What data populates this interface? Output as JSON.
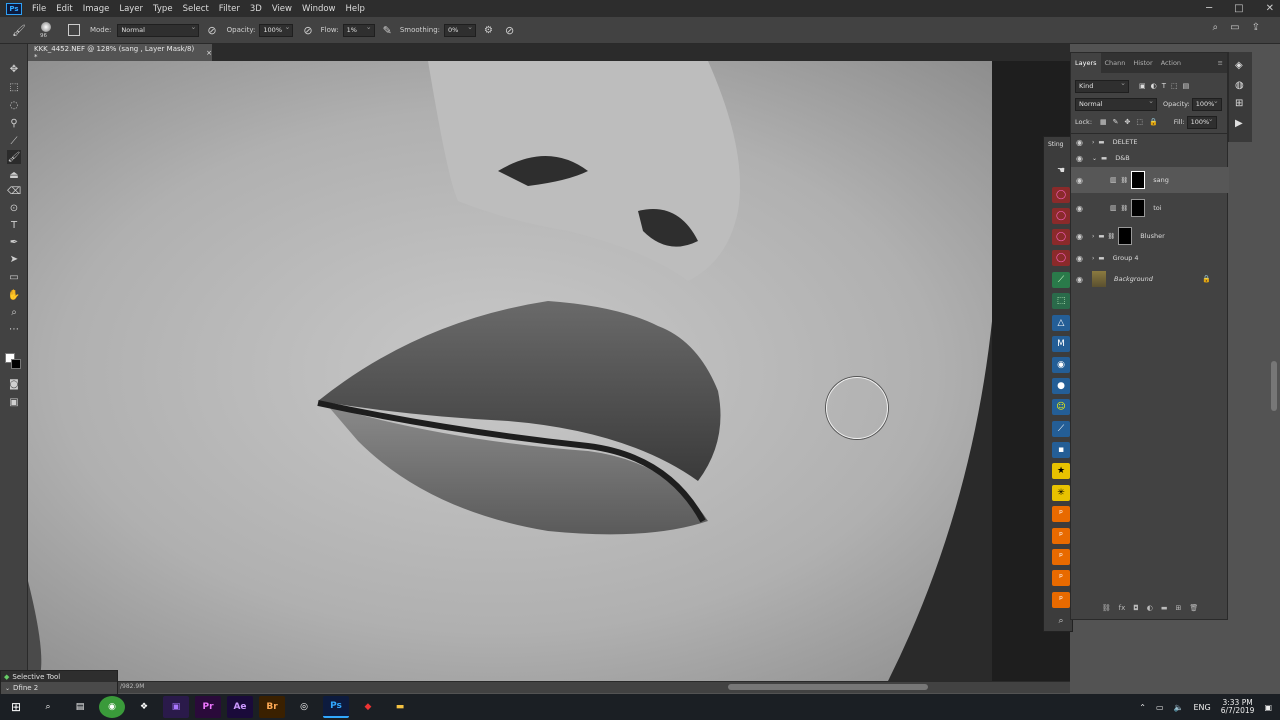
{
  "menubar": {
    "app_icon": "Ps",
    "items": [
      "File",
      "Edit",
      "Image",
      "Layer",
      "Type",
      "Select",
      "Filter",
      "3D",
      "View",
      "Window",
      "Help"
    ]
  },
  "window_controls": {
    "minimize": "─",
    "maximize": "□",
    "close": "✕"
  },
  "options": {
    "brush_size": "96",
    "mode_label": "Mode:",
    "mode_value": "Normal",
    "opacity_label": "Opacity:",
    "opacity_value": "100%",
    "flow_label": "Flow:",
    "flow_value": "1%",
    "smoothing_label": "Smoothing:",
    "smoothing_value": "0%"
  },
  "document": {
    "tab_title": "KKK_4452.NEF @ 128% (sang , Layer Mask/8) *",
    "tab_close": "×",
    "status": "/982.9M"
  },
  "selective_tool": {
    "title": "Selective Tool",
    "item": "Dfine 2"
  },
  "sting": {
    "title": "Sting"
  },
  "layers_panel": {
    "tabs": [
      "Layers",
      "Chann",
      "Histor",
      "Action"
    ],
    "filter_kind": "Kind",
    "blend_mode": "Normal",
    "opacity_label": "Opacity:",
    "opacity_value": "100%",
    "lock_label": "Lock:",
    "fill_label": "Fill:",
    "fill_value": "100%",
    "layers": [
      {
        "name": "DELETE",
        "type": "group"
      },
      {
        "name": "D&B",
        "type": "group-open"
      },
      {
        "name": "sang",
        "type": "mask",
        "selected": true
      },
      {
        "name": "toi",
        "type": "mask"
      },
      {
        "name": "Blusher",
        "type": "group-mask"
      },
      {
        "name": "Group 4",
        "type": "group"
      },
      {
        "name": "Background",
        "type": "background"
      }
    ]
  },
  "taskbar": {
    "lang": "ENG",
    "time": "3:33 PM",
    "date": "6/7/2019",
    "apps": [
      "Pr",
      "Ae",
      "Br",
      "Ps"
    ]
  },
  "colors": {
    "ps_blue": "#31a8ff",
    "panel": "#424242",
    "canvas_bg": "#535353",
    "taskbar": "#1b1f24"
  }
}
